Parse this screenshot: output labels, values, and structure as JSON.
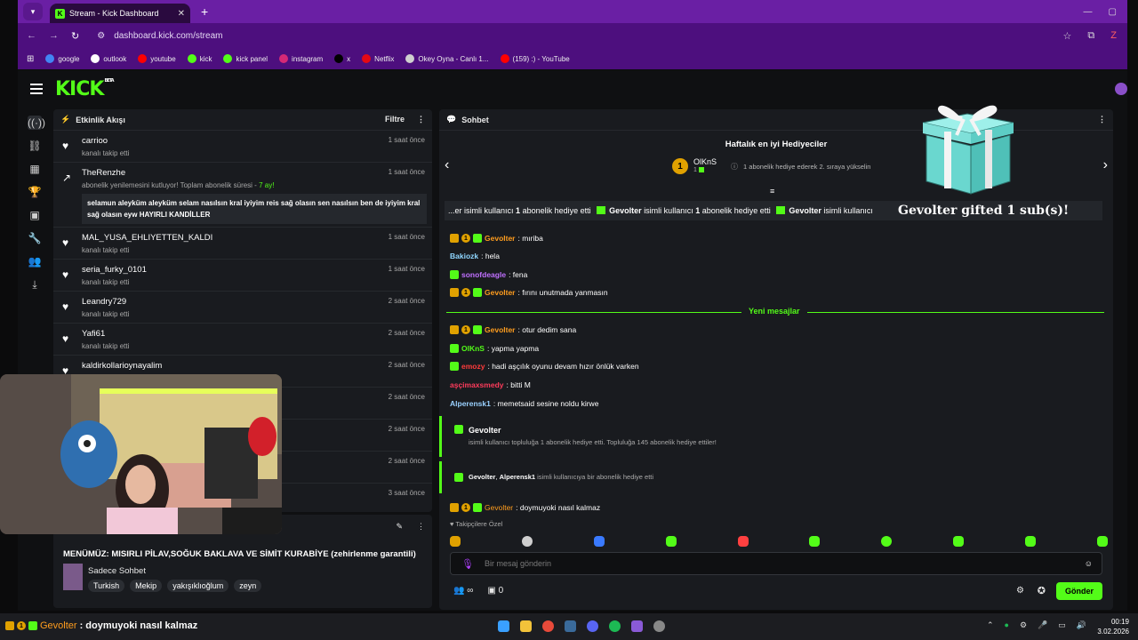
{
  "browser": {
    "tab_title": "Stream - Kick Dashboard",
    "url": "dashboard.kick.com/stream",
    "bookmarks": [
      {
        "label": "google",
        "color": "#4285f4"
      },
      {
        "label": "outlook",
        "color": "#ffffff"
      },
      {
        "label": "youtube",
        "color": "#ff0000"
      },
      {
        "label": "kick",
        "color": "#53fc18"
      },
      {
        "label": "kick panel",
        "color": "#53fc18"
      },
      {
        "label": "instagram",
        "color": "#d62976"
      },
      {
        "label": "x",
        "color": "#000000"
      },
      {
        "label": "Netflix",
        "color": "#e50914"
      },
      {
        "label": "Okey Oyna - Canlı 1...",
        "color": "#cfcfcf"
      },
      {
        "label": "(159) :) - YouTube",
        "color": "#ff0000"
      }
    ]
  },
  "kick": {
    "logo": "KICK",
    "logo_tag": "BETA",
    "activity": {
      "title": "Etkinlik Akışı",
      "filter": "Filtre",
      "events": [
        {
          "user": "carrioo",
          "desc": "kanalı takip etti",
          "time": "1 saat önce"
        },
        {
          "user": "TheRenzhe",
          "desc": "abonelik yenilemesini kutluyor! Toplam abonelik süresi -",
          "months": "7 ay!",
          "time": "1 saat önce",
          "message": "selamun aleyküm aleyküm selam nasılsın kral iyiyim reis sağ olasın sen nasılsın ben de iyiyim kral sağ olasın eyw HAYIRLI KANDİLLER"
        },
        {
          "user": "MAL_YUSA_EHLIYETTEN_KALDI",
          "desc": "kanalı takip etti",
          "time": "1 saat önce"
        },
        {
          "user": "seria_furky_0101",
          "desc": "kanalı takip etti",
          "time": "1 saat önce"
        },
        {
          "user": "Leandry729",
          "desc": "kanalı takip etti",
          "time": "2 saat önce"
        },
        {
          "user": "Yafi61",
          "desc": "kanalı takip etti",
          "time": "2 saat önce"
        },
        {
          "user": "kaldirkollarioynayalim",
          "desc": "",
          "time": "2 saat önce"
        }
      ],
      "hidden_times": [
        "2 saat önce",
        "2 saat önce",
        "2 saat önce",
        "3 saat önce"
      ]
    },
    "stream": {
      "title": "MENÜMÜZ: MISIRLI PİLAV,SOĞUK BAKLAVA VE SİMİT KURABİYE (zehirlenme garantili)",
      "category": "Sadece Sohbet",
      "tags": [
        "Turkish",
        "Mekip",
        "yakışıklıoğlum",
        "zeyn"
      ]
    },
    "chat": {
      "title": "Sohbet",
      "gifters_title": "Haftalık en iyi Hediyeciler",
      "top_gifter": {
        "rank": "1",
        "name": "OlKnS",
        "count": "1"
      },
      "gifter_hint": "1 abonelik hediye ederek 2. sıraya yükselin",
      "ticker": [
        {
          "pre": "...er isimli kullanıcı",
          "n": "1",
          "post": "abonelik hediye etti"
        },
        {
          "name": "Gevolter",
          "pre": "isimli kullanıcı",
          "n": "1",
          "post": "abonelik hediye etti"
        },
        {
          "name": "Gevolter",
          "pre": "isimli kullanıcı",
          "n": "",
          "post": ""
        }
      ],
      "gift_overlay": "Gevolter gifted 1 sub(s)!",
      "messages": [
        {
          "user": "Gevolter",
          "color": "#ff9d1e",
          "text": ": mıriba"
        },
        {
          "user": "Bakiozk",
          "color": "#8fd6ff",
          "text": ": hela"
        },
        {
          "user": "sonofdeagle",
          "color": "#c070ff",
          "text": ": fena"
        },
        {
          "user": "Gevolter",
          "color": "#ff9d1e",
          "text": ": fırını unutmada yanmasın"
        }
      ],
      "new_messages": "Yeni mesajlar",
      "messages2": [
        {
          "user": "Gevolter",
          "color": "#ff9d1e",
          "text": ": otur dedim sana"
        },
        {
          "user": "OlKnS",
          "color": "#53fc18",
          "text": ": yapma yapma"
        },
        {
          "user": "emozy",
          "color": "#ff3b3b",
          "text": ": hadi aşçılık oyunu devam hızır önlük varken"
        },
        {
          "user": "aşçimaxsmedy",
          "color": "#ff3b5b",
          "text": ": bitti M"
        },
        {
          "user": "Alperensk1",
          "color": "#9ad1ff",
          "text": ": memetsaid sesine noldu kirwe"
        }
      ],
      "gift_event1": {
        "user": "Gevolter",
        "text": "isimli kullanıcı topluluğa 1 abonelik hediye etti. Topluluğa 145 abonelik hediye ettiler!"
      },
      "gift_event2": {
        "user": "Gevolter",
        "user2": "Alperensk1",
        "text": "isimli kullanıcıya bir abonelik hediye etti"
      },
      "last_message": {
        "user": "Gevolter",
        "text": ": doymuyoki nasıl kalmaz"
      },
      "emote_label": "Takipçilere Özel",
      "input_placeholder": "Bir mesaj gönderin",
      "bottom_left": "∞",
      "bottom_count": "0",
      "send": "Gönder"
    }
  },
  "taskbar": {
    "chat_user": "Gevolter",
    "chat_text": ": doymuyoki nasıl kalmaz",
    "time": "00:19",
    "date": "3.02.2026"
  }
}
